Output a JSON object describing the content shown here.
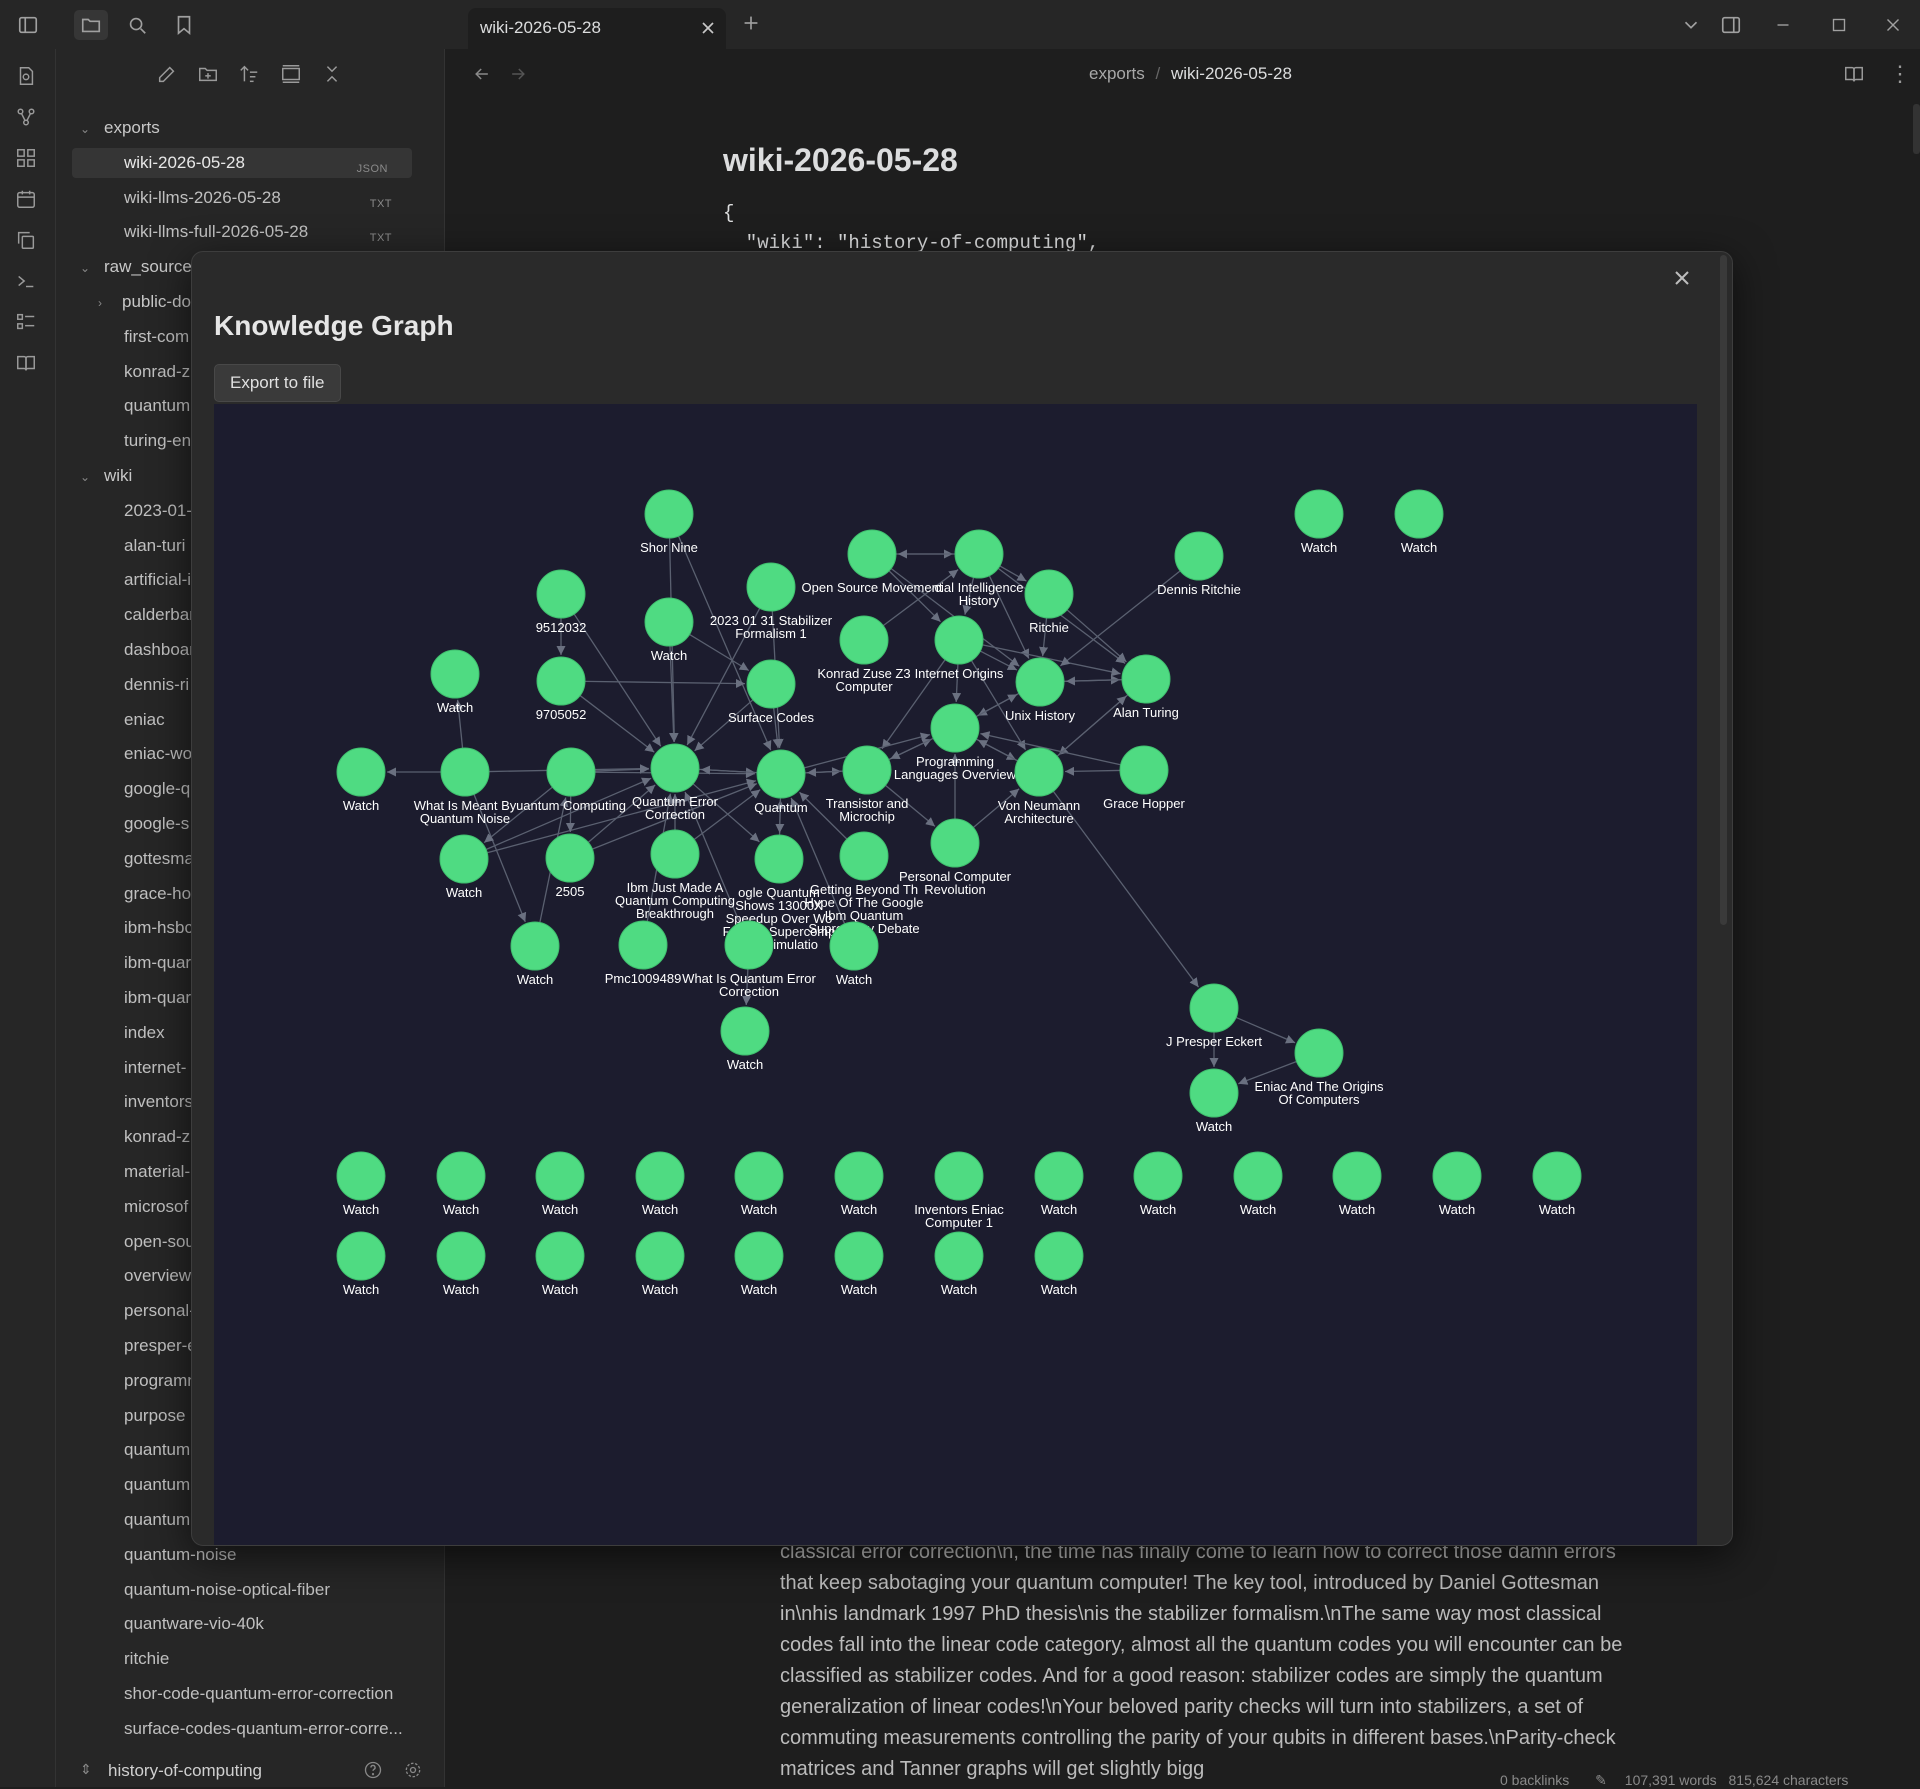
{
  "tab": {
    "title": "wiki-2026-05-28"
  },
  "breadcrumb": {
    "folder": "exports",
    "sep": "/",
    "file": "wiki-2026-05-28"
  },
  "document": {
    "title": "wiki-2026-05-28",
    "code_lines": [
      "{",
      "  \"wiki\": \"history-of-computing\","
    ],
    "body_text": "classical error correction\\n, the time has finally come to learn how to correct those damn errors that keep sabotaging your quantum computer! The key tool, introduced by Daniel Gottesman in\\nhis landmark 1997 PhD thesis\\nis the stabilizer formalism.\\nThe same way most classical codes fall into the linear code category, almost all the quantum codes you will encounter can be classified as stabilizer codes. And for a good reason: stabilizer codes are simply the quantum generalization of linear codes!\\nYour beloved parity checks will turn into stabilizers, a set of commuting measurements controlling the parity of your qubits in different bases.\\nParity-check matrices and Tanner graphs will get slightly bigg"
  },
  "status": {
    "backlinks": "0 backlinks",
    "words": "107,391 words",
    "characters": "815,624 characters"
  },
  "sidebar": {
    "vault_name": "history-of-computing",
    "rows": [
      {
        "label": "exports",
        "kind": "folder",
        "open": true,
        "indent": 0
      },
      {
        "label": "wiki-2026-05-28",
        "kind": "file",
        "badge": "JSON",
        "indent": 1,
        "active": true
      },
      {
        "label": "wiki-llms-2026-05-28",
        "kind": "file",
        "badge": "TXT",
        "indent": 1
      },
      {
        "label": "wiki-llms-full-2026-05-28",
        "kind": "file",
        "badge": "TXT",
        "indent": 1
      },
      {
        "label": "raw_sources",
        "kind": "folder",
        "open": true,
        "indent": 0
      },
      {
        "label": "public-do",
        "kind": "folder",
        "open": false,
        "indent": 1
      },
      {
        "label": "first-com",
        "kind": "file",
        "indent": 1
      },
      {
        "label": "konrad-zu",
        "kind": "file",
        "indent": 1
      },
      {
        "label": "quantum",
        "kind": "file",
        "indent": 1
      },
      {
        "label": "turing-en",
        "kind": "file",
        "indent": 1
      },
      {
        "label": "wiki",
        "kind": "folder",
        "open": true,
        "indent": 0
      },
      {
        "label": "2023-01-",
        "kind": "file",
        "indent": 1
      },
      {
        "label": "alan-turi",
        "kind": "file",
        "indent": 1
      },
      {
        "label": "artificial-i",
        "kind": "file",
        "indent": 1
      },
      {
        "label": "calderbar",
        "kind": "file",
        "indent": 1
      },
      {
        "label": "dashboar",
        "kind": "file",
        "indent": 1
      },
      {
        "label": "dennis-ri",
        "kind": "file",
        "indent": 1
      },
      {
        "label": "eniac",
        "kind": "file",
        "indent": 1
      },
      {
        "label": "eniac-wo",
        "kind": "file",
        "indent": 1
      },
      {
        "label": "google-q",
        "kind": "file",
        "indent": 1
      },
      {
        "label": "google-s",
        "kind": "file",
        "indent": 1
      },
      {
        "label": "gottesma",
        "kind": "file",
        "indent": 1
      },
      {
        "label": "grace-ho",
        "kind": "file",
        "indent": 1
      },
      {
        "label": "ibm-hsbc",
        "kind": "file",
        "indent": 1
      },
      {
        "label": "ibm-quar",
        "kind": "file",
        "indent": 1
      },
      {
        "label": "ibm-quar",
        "kind": "file",
        "indent": 1
      },
      {
        "label": "index",
        "kind": "file",
        "indent": 1
      },
      {
        "label": "internet-",
        "kind": "file",
        "indent": 1
      },
      {
        "label": "inventors",
        "kind": "file",
        "indent": 1
      },
      {
        "label": "konrad-z",
        "kind": "file",
        "indent": 1
      },
      {
        "label": "material-",
        "kind": "file",
        "indent": 1
      },
      {
        "label": "microsof",
        "kind": "file",
        "indent": 1
      },
      {
        "label": "open-sou",
        "kind": "file",
        "indent": 1
      },
      {
        "label": "overview",
        "kind": "file",
        "indent": 1
      },
      {
        "label": "personal-",
        "kind": "file",
        "indent": 1
      },
      {
        "label": "presper-e",
        "kind": "file",
        "indent": 1
      },
      {
        "label": "programn",
        "kind": "file",
        "indent": 1
      },
      {
        "label": "purpose",
        "kind": "file",
        "indent": 1
      },
      {
        "label": "quantum",
        "kind": "file",
        "indent": 1
      },
      {
        "label": "quantum",
        "kind": "file",
        "indent": 1
      },
      {
        "label": "quantum",
        "kind": "file",
        "indent": 1
      },
      {
        "label": "quantum-noise",
        "kind": "file",
        "indent": 1
      },
      {
        "label": "quantum-noise-optical-fiber",
        "kind": "file",
        "indent": 1
      },
      {
        "label": "quantware-vio-40k",
        "kind": "file",
        "indent": 1
      },
      {
        "label": "ritchie",
        "kind": "file",
        "indent": 1
      },
      {
        "label": "shor-code-quantum-error-correction",
        "kind": "file",
        "indent": 1
      },
      {
        "label": "surface-codes-quantum-error-corre...",
        "kind": "file",
        "indent": 1
      }
    ]
  },
  "modal": {
    "title": "Knowledge Graph",
    "export_label": "Export to file"
  },
  "graph": {
    "node_color": "#4fdb82",
    "edge_color": "#5a6070",
    "background": "#1c1c2e",
    "nodes": [
      {
        "id": "shor",
        "label": [
          "Shor Nine"
        ]
      },
      {
        "id": "w_tr1",
        "label": [
          "Watch"
        ]
      },
      {
        "id": "w_tr2",
        "label": [
          "Watch"
        ]
      },
      {
        "id": "osm",
        "label": [
          "Open Source Movement"
        ]
      },
      {
        "id": "aih",
        "label": [
          "cial Intelligence",
          "History"
        ]
      },
      {
        "id": "dennis",
        "label": [
          "Dennis Ritchie"
        ]
      },
      {
        "id": "n9512",
        "label": [
          "9512032"
        ]
      },
      {
        "id": "stab",
        "label": [
          "2023 01 31 Stabilizer",
          "Formalism 1"
        ]
      },
      {
        "id": "w_mid",
        "label": [
          "Watch"
        ]
      },
      {
        "id": "ritchie",
        "label": [
          "Ritchie"
        ]
      },
      {
        "id": "zuse",
        "label": [
          "Konrad Zuse Z3",
          "Computer"
        ]
      },
      {
        "id": "inet",
        "label": [
          "Internet Origins"
        ]
      },
      {
        "id": "w_left",
        "label": [
          "Watch"
        ]
      },
      {
        "id": "n9705",
        "label": [
          "9705052"
        ]
      },
      {
        "id": "surf",
        "label": [
          "Surface Codes"
        ]
      },
      {
        "id": "unix",
        "label": [
          "Unix History"
        ]
      },
      {
        "id": "turing",
        "label": [
          "Alan Turing"
        ]
      },
      {
        "id": "plo",
        "label": [
          "Programming",
          "Languages Overview"
        ]
      },
      {
        "id": "w_far",
        "label": [
          "Watch"
        ]
      },
      {
        "id": "qnoise",
        "label": [
          "What Is Meant By",
          "Quantum Noise"
        ]
      },
      {
        "id": "qcomp",
        "label": [
          "uantum Computing"
        ]
      },
      {
        "id": "qec",
        "label": [
          "Quantum Error",
          "Correction"
        ]
      },
      {
        "id": "quantum",
        "label": [
          "Quantum"
        ]
      },
      {
        "id": "trans",
        "label": [
          "Transistor and",
          "Microchip"
        ]
      },
      {
        "id": "vna",
        "label": [
          "Von Neumann",
          "Architecture"
        ]
      },
      {
        "id": "hopper",
        "label": [
          "Grace Hopper"
        ]
      },
      {
        "id": "w_l2",
        "label": [
          "Watch"
        ]
      },
      {
        "id": "n2505",
        "label": [
          "2505"
        ]
      },
      {
        "id": "ibmbreak",
        "label": [
          "Ibm Just Made A",
          "Quantum Computing",
          "Breakthrough"
        ]
      },
      {
        "id": "gq",
        "label": [
          "ogle Quantum",
          "Shows 13000X",
          "Speedup Over Wo",
          "Fastest Supercomp",
          "In   s Simulatio"
        ]
      },
      {
        "id": "gbh",
        "label": [
          "Getting Beyond Th",
          "Hype Of The Google",
          "Ibm Quantum",
          "Supremacy Debate"
        ]
      },
      {
        "id": "pcr",
        "label": [
          "Personal Computer",
          "Revolution"
        ]
      },
      {
        "id": "w_l3",
        "label": [
          "Watch"
        ]
      },
      {
        "id": "pmc",
        "label": [
          "Pmc1009489"
        ]
      },
      {
        "id": "wiqec",
        "label": [
          "What Is Quantum Error",
          "Correction"
        ]
      },
      {
        "id": "w_gbh",
        "label": [
          "Watch"
        ]
      },
      {
        "id": "w_bot",
        "label": [
          "Watch"
        ]
      },
      {
        "id": "eckert",
        "label": [
          "J Presper Eckert"
        ]
      },
      {
        "id": "eniacorig",
        "label": [
          "Eniac And The Origins",
          "Of Computers"
        ]
      },
      {
        "id": "w_eck",
        "label": [
          "Watch"
        ]
      },
      {
        "id": "r1_1",
        "label": [
          "Watch"
        ]
      },
      {
        "id": "r1_2",
        "label": [
          "Watch"
        ]
      },
      {
        "id": "r1_3",
        "label": [
          "Watch"
        ]
      },
      {
        "id": "r1_4",
        "label": [
          "Watch"
        ]
      },
      {
        "id": "r1_5",
        "label": [
          "Watch"
        ]
      },
      {
        "id": "r1_6",
        "label": [
          "Watch"
        ]
      },
      {
        "id": "r1_7",
        "label": [
          "Inventors Eniac",
          "Computer 1"
        ]
      },
      {
        "id": "r1_8",
        "label": [
          "Watch"
        ]
      },
      {
        "id": "r1_9",
        "label": [
          "Watch"
        ]
      },
      {
        "id": "r1_10",
        "label": [
          "Watch"
        ]
      },
      {
        "id": "r1_11",
        "label": [
          "Watch"
        ]
      },
      {
        "id": "r1_12",
        "label": [
          "Watch"
        ]
      },
      {
        "id": "r1_13",
        "label": [
          "Watch"
        ]
      },
      {
        "id": "r2_1",
        "label": [
          "Watch"
        ]
      },
      {
        "id": "r2_2",
        "label": [
          "Watch"
        ]
      },
      {
        "id": "r2_3",
        "label": [
          "Watch"
        ]
      },
      {
        "id": "r2_4",
        "label": [
          "Watch"
        ]
      },
      {
        "id": "r2_5",
        "label": [
          "Watch"
        ]
      },
      {
        "id": "r2_6",
        "label": [
          "Watch"
        ]
      },
      {
        "id": "r2_7",
        "label": [
          "Watch"
        ]
      },
      {
        "id": "r2_8",
        "label": [
          "Watch"
        ]
      }
    ],
    "edges": [
      [
        "shor",
        "qec"
      ],
      [
        "shor",
        "quantum"
      ],
      [
        "n9512",
        "n9705"
      ],
      [
        "n9512",
        "qec"
      ],
      [
        "w_mid",
        "qec"
      ],
      [
        "w_mid",
        "surf"
      ],
      [
        "stab",
        "qec"
      ],
      [
        "stab",
        "quantum"
      ],
      [
        "surf",
        "qec"
      ],
      [
        "surf",
        "quantum"
      ],
      [
        "n9705",
        "surf"
      ],
      [
        "n9705",
        "qec"
      ],
      [
        "qnoise",
        "w_far"
      ],
      [
        "qnoise",
        "w_left"
      ],
      [
        "qcomp",
        "qec"
      ],
      [
        "qcomp",
        "quantum"
      ],
      [
        "qec",
        "quantum"
      ],
      [
        "quantum",
        "qec"
      ],
      [
        "quantum",
        "trans"
      ],
      [
        "trans",
        "quantum"
      ],
      [
        "qnoise",
        "qec"
      ],
      [
        "w_l2",
        "qec"
      ],
      [
        "w_l2",
        "quantum"
      ],
      [
        "n2505",
        "qec"
      ],
      [
        "n2505",
        "quantum"
      ],
      [
        "ibmbreak",
        "quantum"
      ],
      [
        "ibmbreak",
        "qec"
      ],
      [
        "gbh",
        "quantum"
      ],
      [
        "gq",
        "quantum"
      ],
      [
        "quantum",
        "gq"
      ],
      [
        "wiqec",
        "w_bot"
      ],
      [
        "wiqec",
        "qec"
      ],
      [
        "w_l3",
        "qcomp"
      ],
      [
        "pmc",
        "qec"
      ],
      [
        "w_gbh",
        "quantum"
      ],
      [
        "qec",
        "gq"
      ],
      [
        "qnoise",
        "w_l3"
      ],
      [
        "qcomp",
        "w_l2"
      ],
      [
        "qcomp",
        "n2505"
      ],
      [
        "osm",
        "aih"
      ],
      [
        "osm",
        "inet"
      ],
      [
        "osm",
        "unix"
      ],
      [
        "aih",
        "osm"
      ],
      [
        "aih",
        "ritchie"
      ],
      [
        "aih",
        "unix"
      ],
      [
        "aih",
        "turing"
      ],
      [
        "aih",
        "inet"
      ],
      [
        "zuse",
        "aih"
      ],
      [
        "inet",
        "unix"
      ],
      [
        "inet",
        "turing"
      ],
      [
        "inet",
        "vna"
      ],
      [
        "inet",
        "plo"
      ],
      [
        "ritchie",
        "unix"
      ],
      [
        "ritchie",
        "turing"
      ],
      [
        "dennis",
        "unix"
      ],
      [
        "unix",
        "turing"
      ],
      [
        "turing",
        "unix"
      ],
      [
        "unix",
        "plo"
      ],
      [
        "plo",
        "unix"
      ],
      [
        "plo",
        "vna"
      ],
      [
        "vna",
        "plo"
      ],
      [
        "turing",
        "vna"
      ],
      [
        "vna",
        "turing"
      ],
      [
        "hopper",
        "vna"
      ],
      [
        "hopper",
        "plo"
      ],
      [
        "trans",
        "plo"
      ],
      [
        "trans",
        "pcr"
      ],
      [
        "pcr",
        "vna"
      ],
      [
        "pcr",
        "plo"
      ],
      [
        "plo",
        "trans"
      ],
      [
        "vna",
        "eckert"
      ],
      [
        "inet",
        "trans"
      ],
      [
        "quantum",
        "plo"
      ],
      [
        "eckert",
        "eniacorig"
      ],
      [
        "eckert",
        "w_eck"
      ],
      [
        "eniacorig",
        "w_eck"
      ]
    ]
  }
}
